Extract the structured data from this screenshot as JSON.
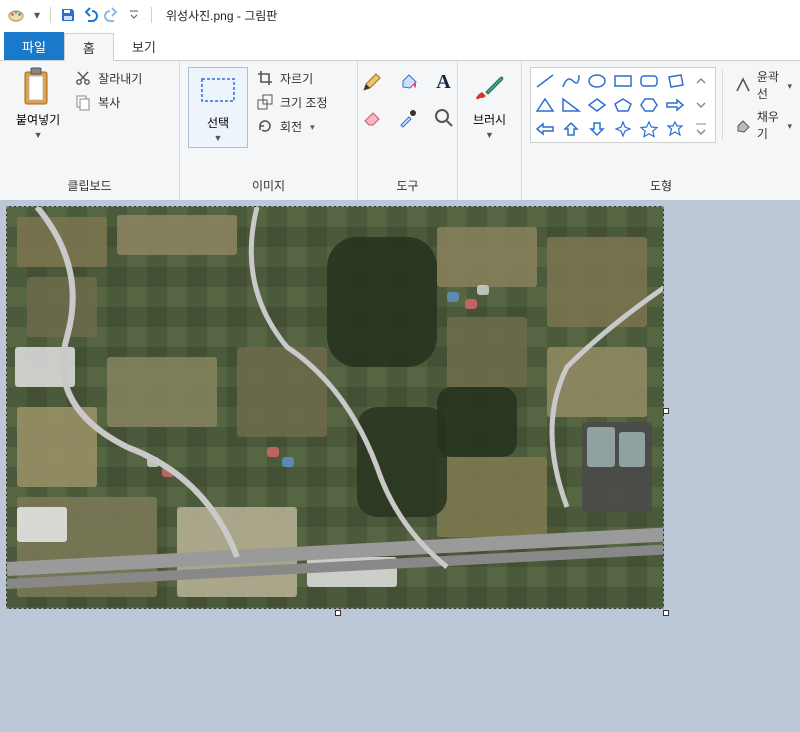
{
  "title": {
    "filename": "위성사진.png",
    "app": "그림판"
  },
  "tabs": {
    "file": "파일",
    "home": "홈",
    "view": "보기"
  },
  "clipboard": {
    "paste": "붙여넣기",
    "cut": "잘라내기",
    "copy": "복사",
    "group": "클립보드"
  },
  "image": {
    "select": "선택",
    "crop": "자르기",
    "resize": "크기 조정",
    "rotate": "회전",
    "group": "이미지"
  },
  "tools": {
    "group": "도구"
  },
  "brushes": {
    "label": "브러시"
  },
  "shapes": {
    "outline": "윤곽선",
    "fill": "채우기",
    "group": "도형"
  }
}
